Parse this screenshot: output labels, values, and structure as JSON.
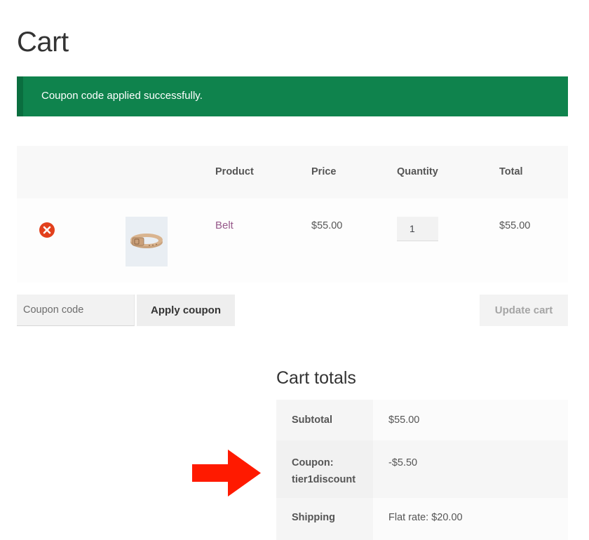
{
  "page": {
    "title": "Cart"
  },
  "notice": {
    "message": "Coupon code applied successfully."
  },
  "cart": {
    "headers": {
      "product": "Product",
      "price": "Price",
      "quantity": "Quantity",
      "total": "Total"
    },
    "items": [
      {
        "product": "Belt",
        "price": "$55.00",
        "quantity": "1",
        "total": "$55.00"
      }
    ]
  },
  "actions": {
    "coupon_placeholder": "Coupon code",
    "apply_label": "Apply coupon",
    "update_label": "Update cart"
  },
  "totals": {
    "title": "Cart totals",
    "subtotal_label": "Subtotal",
    "subtotal_value": "$55.00",
    "coupon_label_line1": "Coupon:",
    "coupon_label_line2": "tier1discount",
    "coupon_value": "-$5.50",
    "shipping_label": "Shipping",
    "shipping_value": "Flat rate: $20.00"
  },
  "colors": {
    "notice_bg": "#0f834d",
    "link": "#96588a",
    "remove_icon": "#e2401c",
    "arrow": "#ff1a00"
  },
  "icons": {
    "remove": "remove-circle-x-icon",
    "annotation": "right-arrow-icon"
  }
}
